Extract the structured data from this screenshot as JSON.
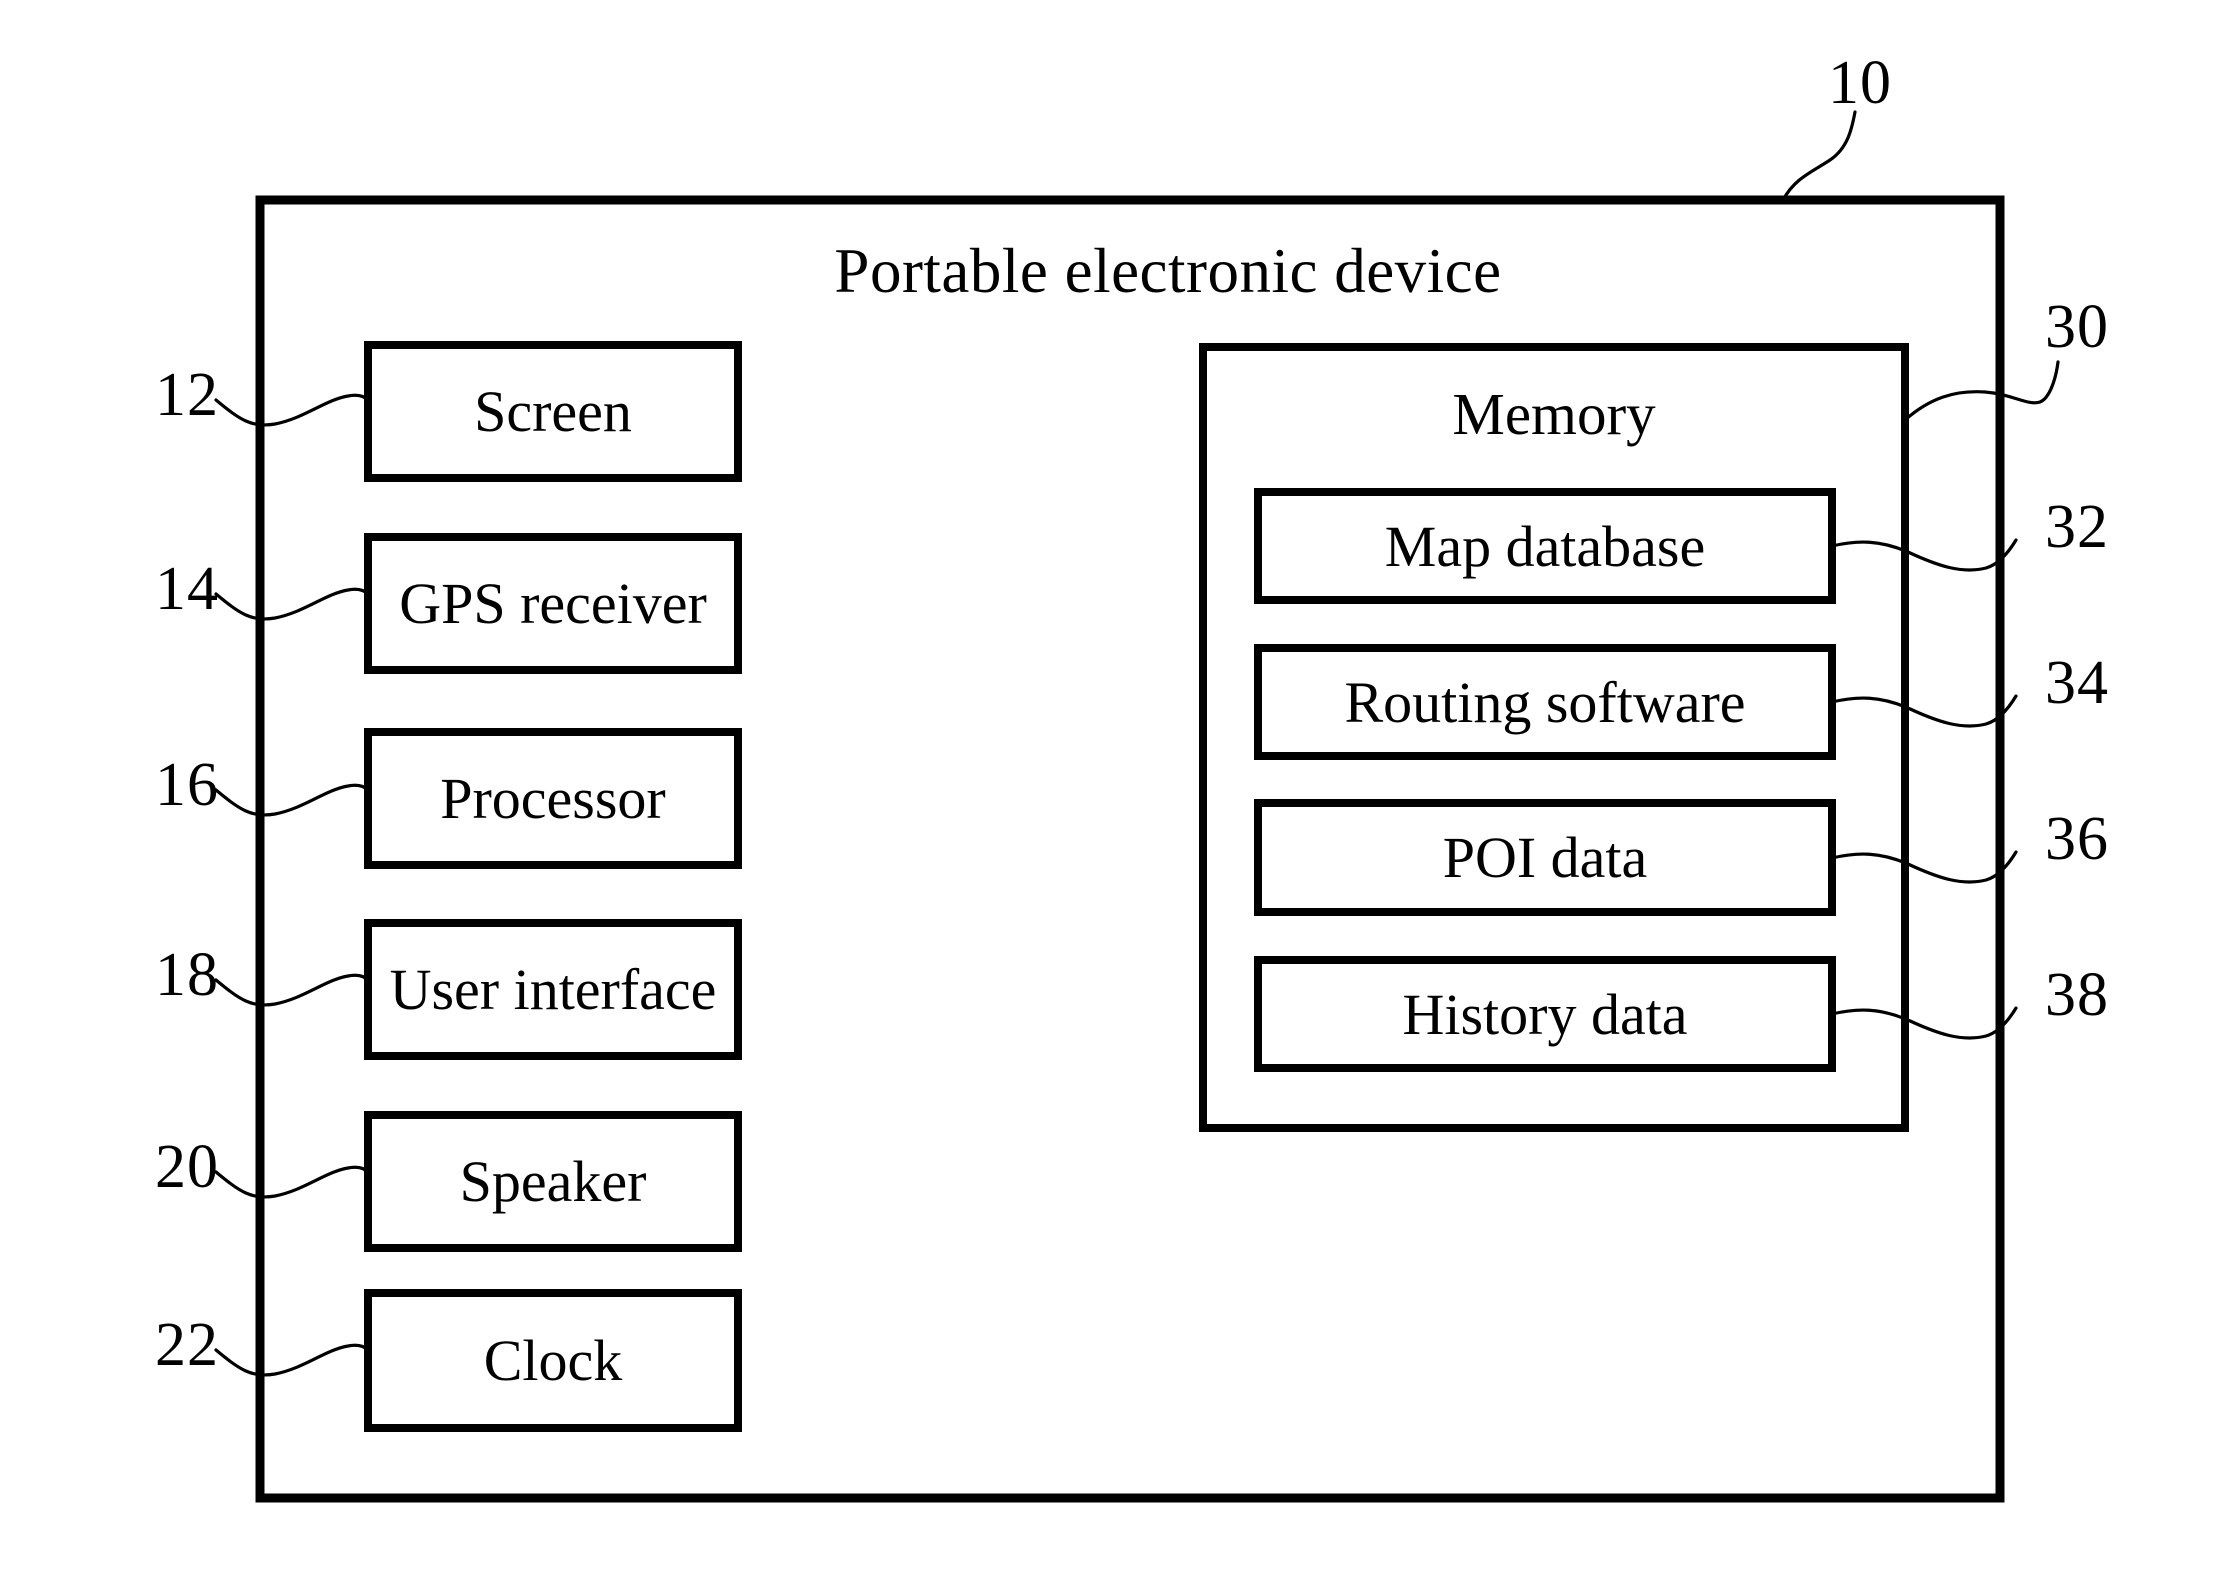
{
  "figure": {
    "title": "Portable electronic device",
    "device_ref": "10",
    "background_color": "#ffffff",
    "line_color": "#000000"
  },
  "components": [
    {
      "ref": "12",
      "label": "Screen"
    },
    {
      "ref": "14",
      "label": "GPS receiver"
    },
    {
      "ref": "16",
      "label": "Processor"
    },
    {
      "ref": "18",
      "label": "User interface"
    },
    {
      "ref": "20",
      "label": "Speaker"
    },
    {
      "ref": "22",
      "label": "Clock"
    }
  ],
  "memory": {
    "ref": "30",
    "label": "Memory",
    "items": [
      {
        "ref": "32",
        "label": "Map database"
      },
      {
        "ref": "34",
        "label": "Routing software"
      },
      {
        "ref": "36",
        "label": "POI data"
      },
      {
        "ref": "38",
        "label": "History data"
      }
    ]
  }
}
